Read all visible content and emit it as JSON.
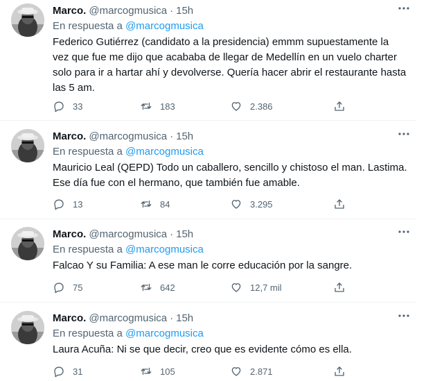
{
  "tweets": [
    {
      "name": "Marco.",
      "handle": "@marcogmusica",
      "dot": "·",
      "time": "15h",
      "reply_prefix": "En respuesta a ",
      "reply_to": "@marcogmusica",
      "text": "Federico Gutiérrez (candidato a la presidencia) emmm supuestamente la vez que fue me dijo que acababa de llegar de Medellín en un vuelo charter solo para ir a hartar ahí y devolverse. Quería hacer abrir el restaurante hasta las 5 am.",
      "replies": "33",
      "retweets": "183",
      "likes": "2.386"
    },
    {
      "name": "Marco.",
      "handle": "@marcogmusica",
      "dot": "·",
      "time": "15h",
      "reply_prefix": "En respuesta a ",
      "reply_to": "@marcogmusica",
      "text": "Mauricio Leal (QEPD) Todo un caballero, sencillo y chistoso el man. Lastima. Ese día fue con el hermano, que también fue amable.",
      "replies": "13",
      "retweets": "84",
      "likes": "3.295"
    },
    {
      "name": "Marco.",
      "handle": "@marcogmusica",
      "dot": "·",
      "time": "15h",
      "reply_prefix": "En respuesta a ",
      "reply_to": "@marcogmusica",
      "text": "Falcao Y su Familia: A ese man le corre educación por la sangre.",
      "replies": "75",
      "retweets": "642",
      "likes": "12,7 mil"
    },
    {
      "name": "Marco.",
      "handle": "@marcogmusica",
      "dot": "·",
      "time": "15h",
      "reply_prefix": "En respuesta a ",
      "reply_to": "@marcogmusica",
      "text": "Laura Acuña: Ni se que decir, creo que es evidente cómo es ella.",
      "replies": "31",
      "retweets": "105",
      "likes": "2.871"
    }
  ]
}
